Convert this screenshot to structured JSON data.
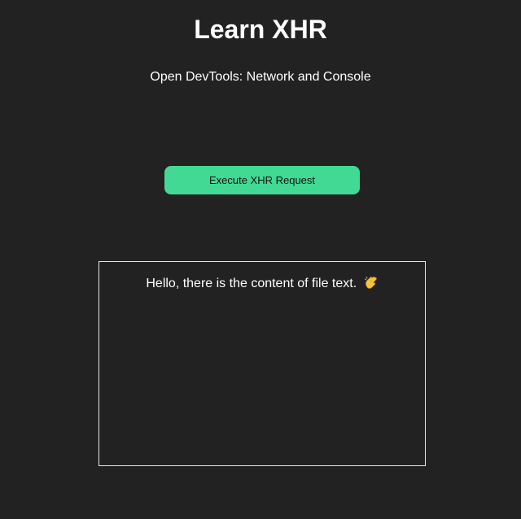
{
  "page": {
    "title": "Learn XHR",
    "subtitle": "Open DevTools: Network and Console"
  },
  "button": {
    "label": "Execute XHR Request",
    "color": "#42d994"
  },
  "output": {
    "text": "Hello, there is the content of file text.",
    "icon": "clapping-hands-icon"
  },
  "colors": {
    "background": "#222222",
    "text": "#ffffff",
    "border": "#e6e6e6"
  }
}
